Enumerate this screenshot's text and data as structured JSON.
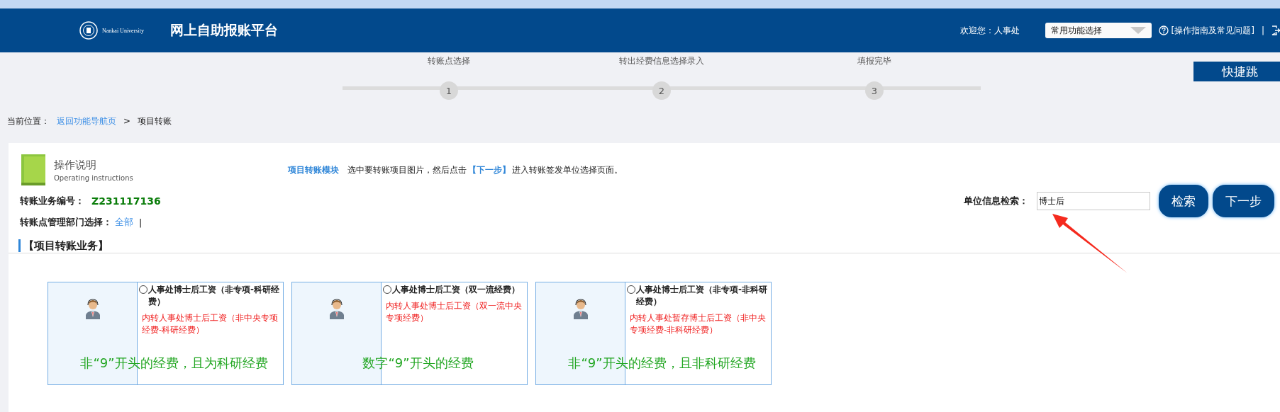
{
  "header": {
    "title": "网上自助报账平台",
    "logo_text": "Nankai University",
    "welcome": "欢迎您：人事处",
    "function_select": "常用功能选择",
    "help_link": "[操作指南及常见问题]",
    "separator": "|"
  },
  "steps": [
    {
      "number": "1",
      "label": "转账点选择"
    },
    {
      "number": "2",
      "label": "转出经费信息选择录入"
    },
    {
      "number": "3",
      "label": "填报完毕"
    }
  ],
  "quick_jump": "快捷跳",
  "breadcrumb": {
    "label": "当前位置：",
    "link": "返回功能导航页",
    "separator": ">",
    "current": "项目转账"
  },
  "instructions": {
    "title": "操作说明",
    "subtitle": "Operating instructions",
    "module": "项目转账模块",
    "text": "选中要转账项目图片，然后点击",
    "highlight": "【下一步】",
    "text_end": "进入转账签发单位选择页面。"
  },
  "business_number": {
    "label": "转账业务编号：",
    "value": "Z231117136"
  },
  "department": {
    "label": "转账点管理部门选择：",
    "link": "全部",
    "separator": "|"
  },
  "search": {
    "label": "单位信息检索：",
    "value": "博士后",
    "buttons": [
      "检索",
      "下一步"
    ]
  },
  "section_title": "【项目转账业务】",
  "cards": [
    {
      "title": "人事处博士后工资（非专项-科研经费）",
      "description": "内转人事处博士后工资（非中央专项经费-科研经费）",
      "note": "非“9”开头的经费，且为科研经费",
      "selected": false
    },
    {
      "title": "人事处博士后工资（双一流经费）",
      "description": "内转人事处博士后工资（双一流中央专项经费）",
      "note": "数字“9”开头的经费",
      "selected": false
    },
    {
      "title": "人事处博士后工资（非专项-非科研经费）",
      "description": "内转人事处暂存博士后工资（非中央专项经费-非科研经费）",
      "note": "非“9”开头的经费，且非科研经费",
      "selected": false
    }
  ]
}
